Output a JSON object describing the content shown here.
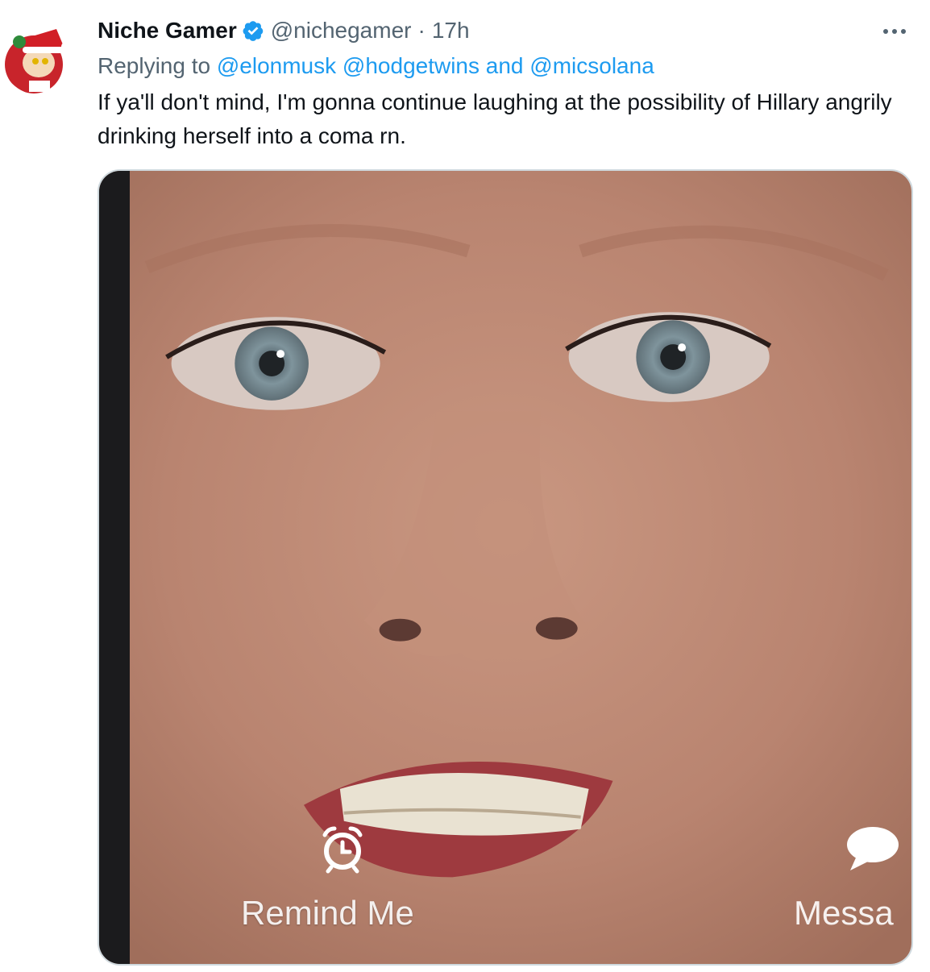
{
  "tweet": {
    "display_name": "Niche Gamer",
    "handle": "@nichegamer",
    "separator": "·",
    "time": "17h",
    "reply_prefix": "Replying to",
    "mentions": [
      "@elonmusk",
      "@hodgetwins",
      "@micsolana"
    ],
    "mention_joiner": "and",
    "text": "If ya'll don't mind, I'm gonna continue laughing at the possibility of Hillary angrily drinking herself into a coma rn.",
    "verified_icon": "verified-badge-icon",
    "more_icon": "more-options-icon"
  },
  "media": {
    "remind_label": "Remind Me",
    "message_label": "Messa",
    "remind_icon": "alarm-clock-icon",
    "message_icon": "speech-bubble-icon"
  },
  "colors": {
    "text_primary": "#0f1419",
    "text_secondary": "#536471",
    "link_blue": "#1d9bf0",
    "verified_blue": "#1d9bf0",
    "border": "#cfd9de"
  }
}
